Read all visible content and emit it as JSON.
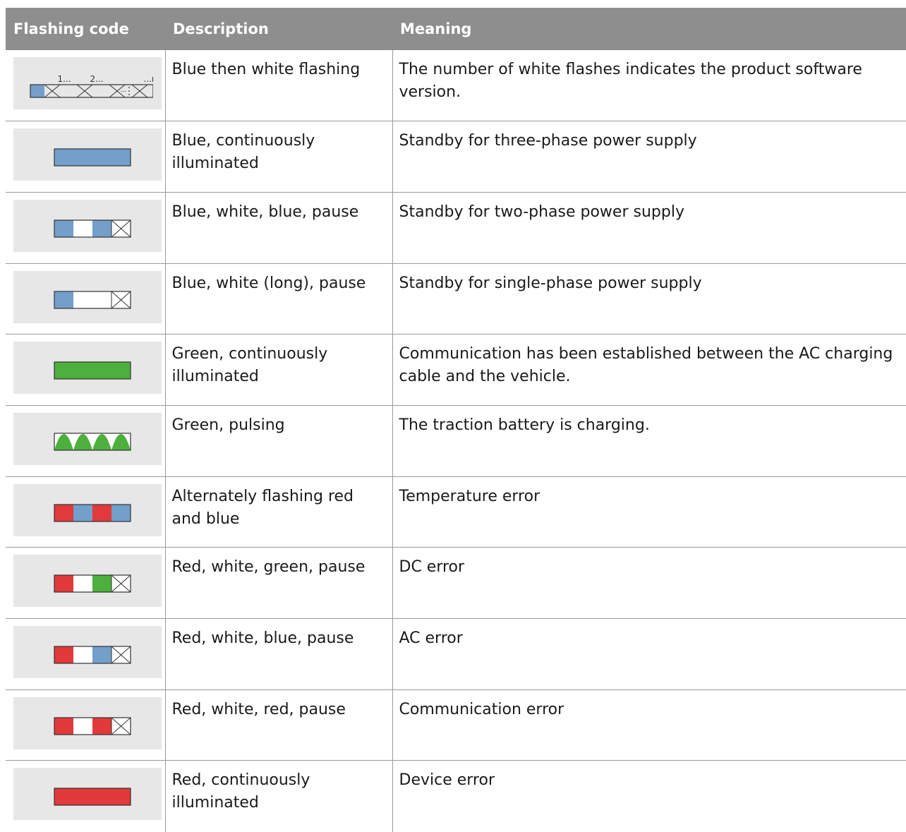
{
  "header": {
    "col1": "Flashing code",
    "col2": "Description",
    "col3": "Meaning"
  },
  "colors": {
    "blue": "#739fcb",
    "green": "#4daf3c",
    "red": "#e2393a",
    "white": "#ffffff",
    "outline": "#333333",
    "cell_bg": "#e7e7e7",
    "header_bg": "#8e8e8e"
  },
  "rows": [
    {
      "description": "Blue then white flashing",
      "meaning": "The number of white flashes indicates the product software version.",
      "pattern": "version",
      "labels": [
        "1...",
        "2...",
        "...",
        "...n"
      ]
    },
    {
      "description": "Blue, continuously illuminated",
      "meaning": "Standby for three-phase power supply",
      "pattern": "solid-blue"
    },
    {
      "description": "Blue, white, blue, pause",
      "meaning": "Standby for two-phase power supply",
      "pattern": "blue-white-blue-pause"
    },
    {
      "description": "Blue, white (long), pause",
      "meaning": "Standby for single-phase power supply",
      "pattern": "blue-whitelong-pause"
    },
    {
      "description": "Green, continuously illuminated",
      "meaning": "Communication has been established between the AC charging cable and the vehicle.",
      "pattern": "solid-green"
    },
    {
      "description": "Green, pulsing",
      "meaning": "The traction battery is charging.",
      "pattern": "green-pulsing"
    },
    {
      "description": "Alternately flashing red and blue",
      "meaning": "Temperature error",
      "pattern": "red-blue-alternating"
    },
    {
      "description": "Red, white, green, pause",
      "meaning": "DC error",
      "pattern": "red-white-green-pause"
    },
    {
      "description": "Red, white, blue, pause",
      "meaning": "AC error",
      "pattern": "red-white-blue-pause"
    },
    {
      "description": "Red, white, red, pause",
      "meaning": "Communication error",
      "pattern": "red-white-red-pause"
    },
    {
      "description": "Red, continuously illuminated",
      "meaning": "Device error",
      "pattern": "solid-red"
    }
  ]
}
